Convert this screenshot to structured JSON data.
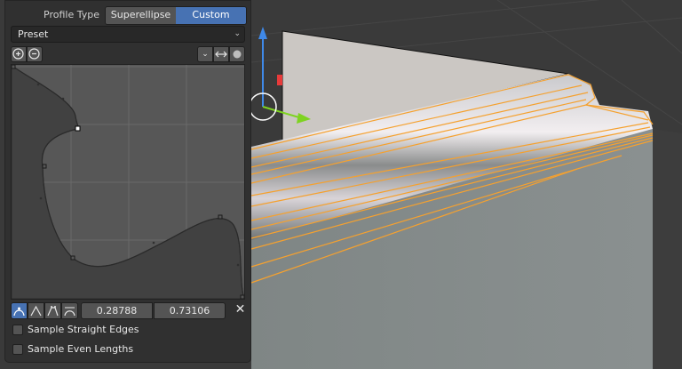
{
  "profile_type": {
    "label": "Profile Type",
    "options": [
      "Superellipse",
      "Custom"
    ],
    "selected": "Custom"
  },
  "preset": {
    "label": "Preset"
  },
  "curve_toolbar": {
    "zoom_in_icon": "zoom-in-icon",
    "zoom_out_icon": "zoom-out-icon",
    "menu_chevron": "chevron-down-icon",
    "reverse_icon": "reverse-path-icon",
    "reset_icon": "reset-view-icon"
  },
  "selected_point": {
    "x": "0.28788",
    "y": "0.73106"
  },
  "options": {
    "sample_straight_edges": {
      "label": "Sample Straight Edges",
      "checked": false
    },
    "sample_even_lengths": {
      "label": "Sample Even Lengths",
      "checked": false
    }
  },
  "colors": {
    "accent": "#4772b3",
    "selection_orange": "#f5a12f",
    "mesh_gray": "#838a89"
  }
}
